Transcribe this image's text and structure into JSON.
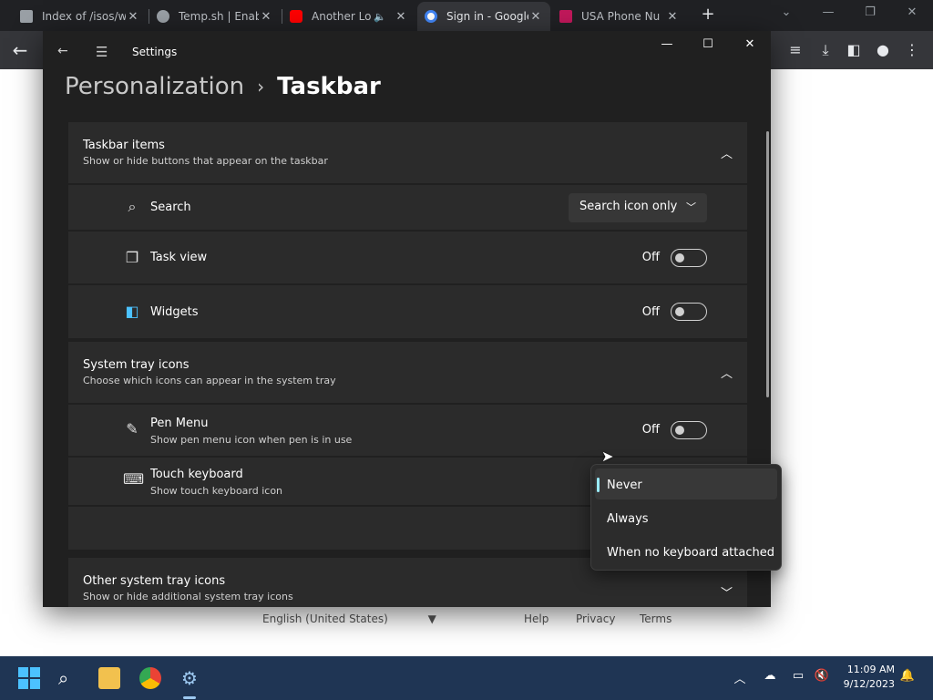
{
  "browser": {
    "tabs": [
      {
        "title": "Index of /isos/w",
        "active": false
      },
      {
        "title": "Temp.sh | Enabl",
        "active": false
      },
      {
        "title": "Another Lo",
        "active": false
      },
      {
        "title": "Sign in - Google",
        "active": true
      },
      {
        "title": "USA Phone Nu",
        "active": false
      }
    ],
    "new_tab": "+"
  },
  "settings": {
    "app_title": "Settings",
    "breadcrumb_parent": "Personalization",
    "breadcrumb_sep": "›",
    "breadcrumb_current": "Taskbar",
    "taskbar_items": {
      "title": "Taskbar items",
      "subtitle": "Show or hide buttons that appear on the taskbar",
      "search_label": "Search",
      "search_value": "Search icon only",
      "taskview_label": "Task view",
      "taskview_state": "Off",
      "widgets_label": "Widgets",
      "widgets_state": "Off"
    },
    "system_tray": {
      "title": "System tray icons",
      "subtitle": "Choose which icons can appear in the system tray",
      "pen_label": "Pen Menu",
      "pen_sub": "Show pen menu icon when pen is in use",
      "pen_state": "Off",
      "touch_label": "Touch keyboard",
      "touch_sub": "Show touch keyboard icon"
    },
    "other_tray": {
      "title": "Other system tray icons",
      "subtitle": "Show or hide additional system tray icons"
    }
  },
  "flyout": {
    "options": [
      "Never",
      "Always",
      "When no keyboard attached"
    ],
    "selected": "Never"
  },
  "page_footer": {
    "language": "English (United States)",
    "help": "Help",
    "privacy": "Privacy",
    "terms": "Terms"
  },
  "taskbar": {
    "time": "11:09 AM",
    "date": "9/12/2023"
  }
}
